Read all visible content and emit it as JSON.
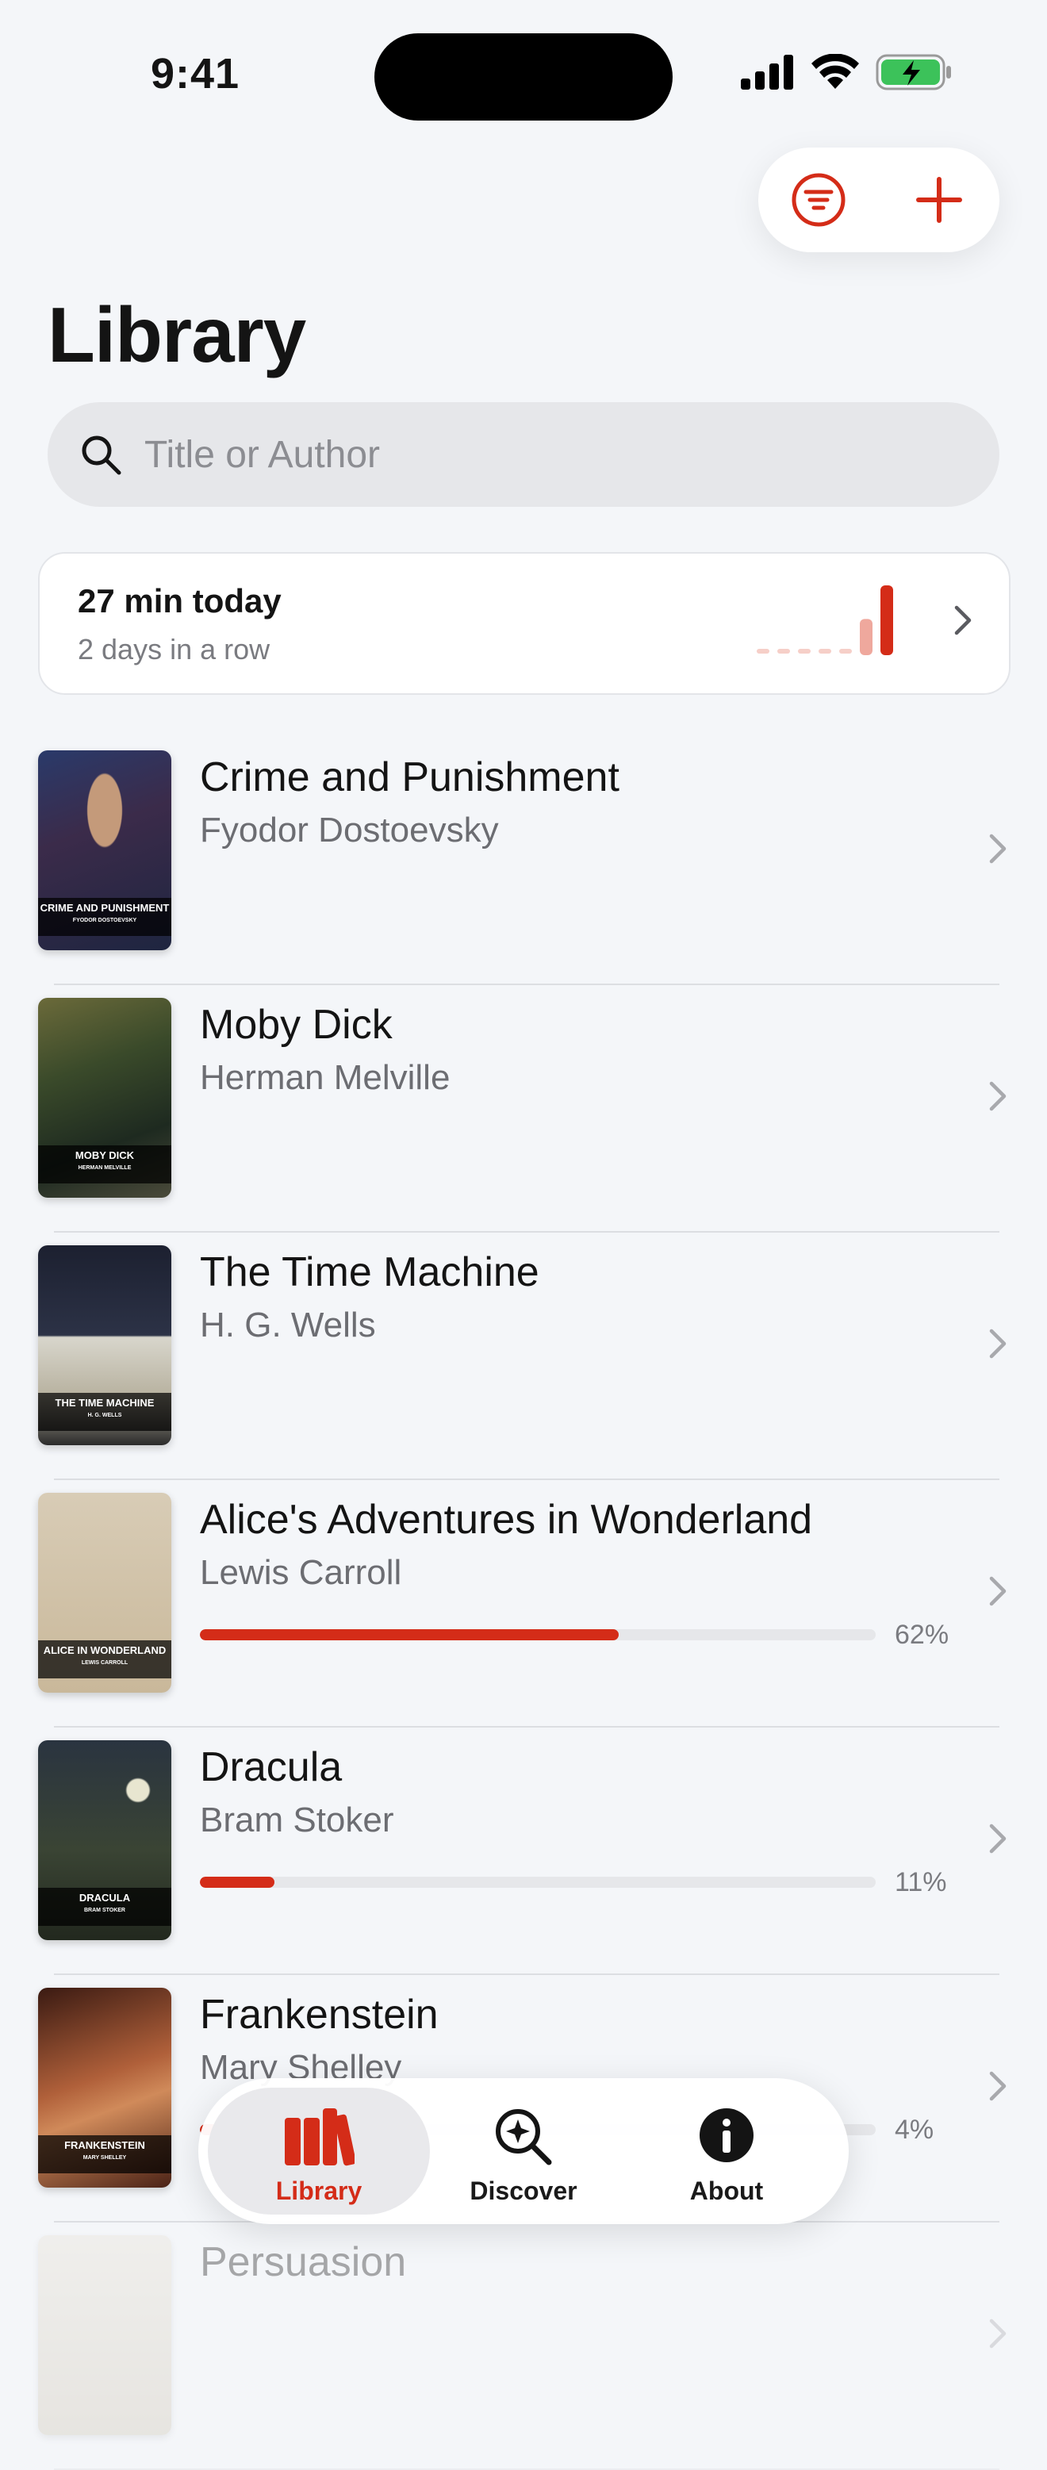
{
  "status_bar": {
    "time": "9:41"
  },
  "page": {
    "title": "Library"
  },
  "search": {
    "placeholder": "Title or Author"
  },
  "reading_stats": {
    "today": "27 min today",
    "streak": "2 days in a row",
    "daily_minutes": [
      0,
      0,
      0,
      0,
      0,
      14,
      27
    ]
  },
  "books": [
    {
      "title": "Crime and Punishment",
      "author": "Fyodor Dostoevsky",
      "cover_title": "CRIME AND PUNISHMENT",
      "cover_sub": "FYODOR DOSTOEVSKY",
      "progress": null
    },
    {
      "title": "Moby Dick",
      "author": "Herman Melville",
      "cover_title": "MOBY DICK",
      "cover_sub": "HERMAN MELVILLE",
      "progress": null
    },
    {
      "title": "The Time Machine",
      "author": "H. G. Wells",
      "cover_title": "THE TIME MACHINE",
      "cover_sub": "H. G. WELLS",
      "progress": null
    },
    {
      "title": "Alice's Adventures in Wonderland",
      "author": "Lewis Carroll",
      "cover_title": "ALICE IN WONDERLAND",
      "cover_sub": "LEWIS CARROLL",
      "progress": 0.62,
      "progress_label": "62%"
    },
    {
      "title": "Dracula",
      "author": "Bram Stoker",
      "cover_title": "DRACULA",
      "cover_sub": "BRAM STOKER",
      "progress": 0.11,
      "progress_label": "11%"
    },
    {
      "title": "Frankenstein",
      "author": "Mary Shelley",
      "cover_title": "FRANKENSTEIN",
      "cover_sub": "MARY SHELLEY",
      "progress": 0.04,
      "progress_label": "4%"
    },
    {
      "title": "Persuasion",
      "author": "",
      "cover_title": "",
      "cover_sub": "",
      "progress": null
    }
  ],
  "tabs": [
    {
      "label": "Library",
      "icon": "books-icon",
      "active": true
    },
    {
      "label": "Discover",
      "icon": "discover-icon",
      "active": false
    },
    {
      "label": "About",
      "icon": "info-icon",
      "active": false
    }
  ],
  "colors": {
    "accent": "#d42c18",
    "accent_light": "#efa89d",
    "background": "#f4f6f9"
  }
}
